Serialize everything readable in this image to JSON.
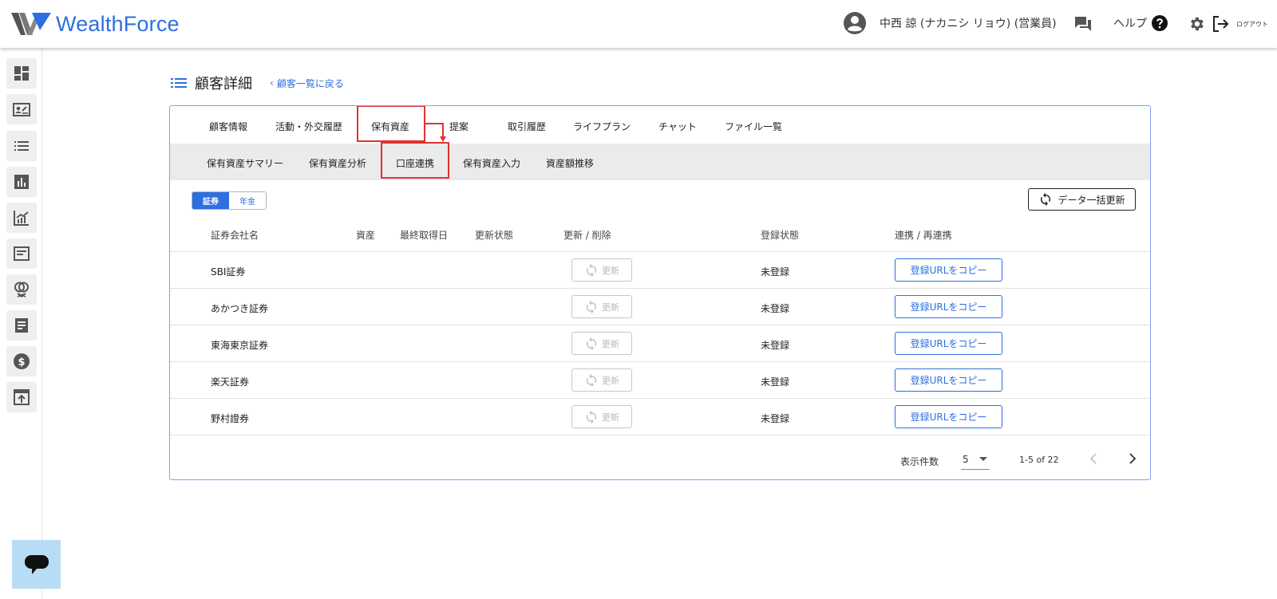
{
  "app": {
    "brand": "WealthForce",
    "brand_color": "#2d6fe0"
  },
  "header": {
    "user_name": "中西 諒 (ナカニシ リョウ) (営業員)",
    "help_label": "ヘルプ",
    "logout_label": "ログアウト",
    "icons": [
      "account-circle-icon",
      "chat-icon",
      "help-icon",
      "gear-icon",
      "logout-icon"
    ]
  },
  "sidebar": {
    "items": [
      {
        "icon": "dashboard-icon"
      },
      {
        "icon": "customer-card-icon"
      },
      {
        "icon": "list-icon"
      },
      {
        "icon": "bar-chart-icon"
      },
      {
        "icon": "analytics-icon"
      },
      {
        "icon": "article-icon"
      },
      {
        "icon": "rings-icon"
      },
      {
        "icon": "document-icon"
      },
      {
        "icon": "dollar-icon"
      },
      {
        "icon": "upload-icon"
      }
    ]
  },
  "page": {
    "title": "顧客詳細",
    "back_link": "顧客一覧に戻る"
  },
  "tabs": [
    "顧客情報",
    "活動・外交履歴",
    "保有資産",
    "提案",
    "取引履歴",
    "ライフプラン",
    "チャット",
    "ファイル一覧"
  ],
  "subtabs": [
    "保有資産サマリー",
    "保有資産分析",
    "口座連携",
    "保有資産入力",
    "資産額推移"
  ],
  "segment": {
    "options": [
      "証券",
      "年金"
    ],
    "selected": "証券"
  },
  "bulk_update_label": "データ一括更新",
  "table": {
    "headers": [
      "証券会社名",
      "資産",
      "最終取得日",
      "更新状態",
      "更新 / 削除",
      "登録状態",
      "連携 / 再連携"
    ],
    "rows": [
      {
        "name": "SBI証券",
        "update_label": "更新",
        "status": "未登録",
        "action": "登録URLをコピー"
      },
      {
        "name": "あかつき証券",
        "update_label": "更新",
        "status": "未登録",
        "action": "登録URLをコピー"
      },
      {
        "name": "東海東京証券",
        "update_label": "更新",
        "status": "未登録",
        "action": "登録URLをコピー"
      },
      {
        "name": "楽天証券",
        "update_label": "更新",
        "status": "未登録",
        "action": "登録URLをコピー"
      },
      {
        "name": "野村證券",
        "update_label": "更新",
        "status": "未登録",
        "action": "登録URLをコピー"
      }
    ]
  },
  "pagination": {
    "label": "表示件数",
    "per_page": "5",
    "range": "1-5 of 22"
  },
  "highlight_color": "#e53030"
}
